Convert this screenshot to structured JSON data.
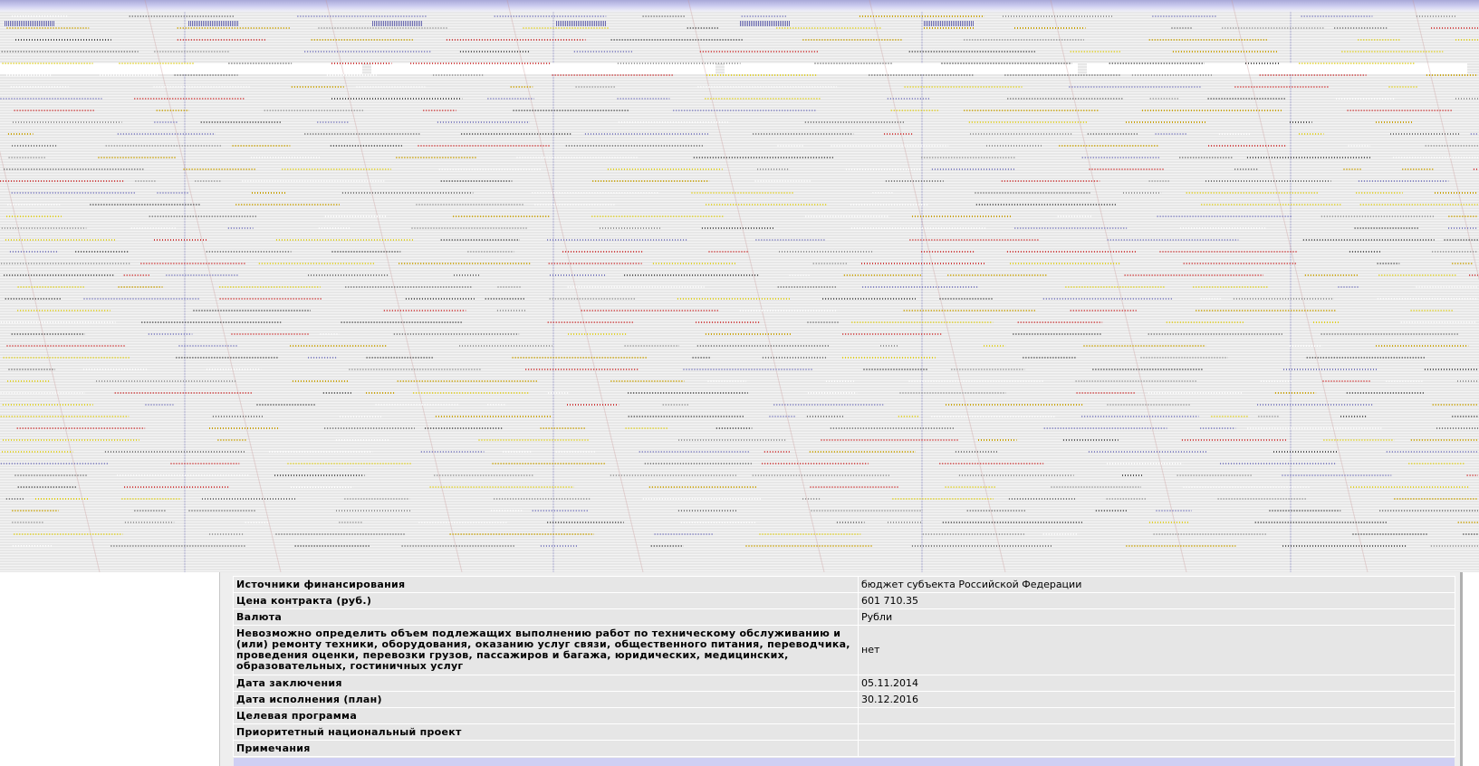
{
  "contract": {
    "rows": [
      {
        "label": "Источники финансирования",
        "value": "бюджет субъекта Российской Федерации"
      },
      {
        "label": "Цена контракта (руб.)",
        "value": "601 710.35"
      },
      {
        "label": "Валюта",
        "value": "Рубли"
      },
      {
        "label": "Невозможно определить объем подлежащих выполнению работ по техническому обслуживанию и (или) ремонту техники, оборудования, оказанию услуг связи, общественного питания, переводчика, проведения оценки, перевозки грузов, пассажиров и багажа, юридических, медицинских, образовательных, гостиничных услуг",
        "value": "нет"
      },
      {
        "label": "Дата заключения",
        "value": "05.11.2014"
      },
      {
        "label": "Дата исполнения (план)",
        "value": "30.12.2016"
      },
      {
        "label": "Целевая программа",
        "value": ""
      },
      {
        "label": "Приоритетный национальный проект",
        "value": ""
      },
      {
        "label": "Примечания",
        "value": ""
      }
    ]
  },
  "colors": {
    "footer_bar": "#cfcff3",
    "row_background": "#e6e6e6"
  }
}
